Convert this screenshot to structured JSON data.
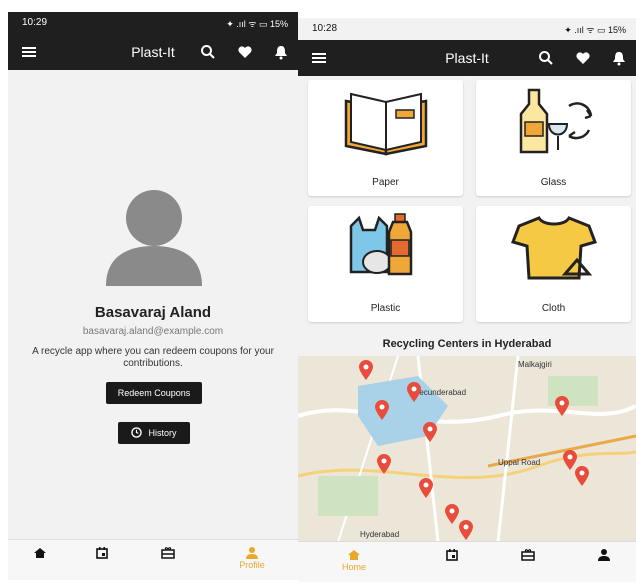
{
  "left": {
    "status": {
      "time": "10:29",
      "indicators": "✦ .ııl ᯤ ▭ 15%"
    },
    "appbar": {
      "title": "Plast-It"
    },
    "profile": {
      "name": "Basavaraj Aland",
      "email": "basavaraj.aland@example.com",
      "description": "A recycle app where you can redeem coupons for your contributions.",
      "redeem_label": "Redeem Coupons",
      "history_label": "History"
    },
    "nav": {
      "profile_label": "Profile"
    }
  },
  "right": {
    "status": {
      "time": "10:28",
      "indicators": "✦ .ııl ᯤ ▭ 15%"
    },
    "appbar": {
      "title": "Plast-It"
    },
    "categories": [
      {
        "label": "Paper"
      },
      {
        "label": "Glass"
      },
      {
        "label": "Plastic"
      },
      {
        "label": "Cloth"
      }
    ],
    "map": {
      "title": "Recycling Centers in Hyderabad",
      "labels": [
        "Malkajgiri",
        "Secunderabad",
        "Uppal Road",
        "Hyderabad"
      ]
    },
    "nav": {
      "home_label": "Home"
    }
  },
  "colors": {
    "bar": "#1f1f1f",
    "accent": "#e8a92b",
    "pin": "#e74c3c"
  }
}
